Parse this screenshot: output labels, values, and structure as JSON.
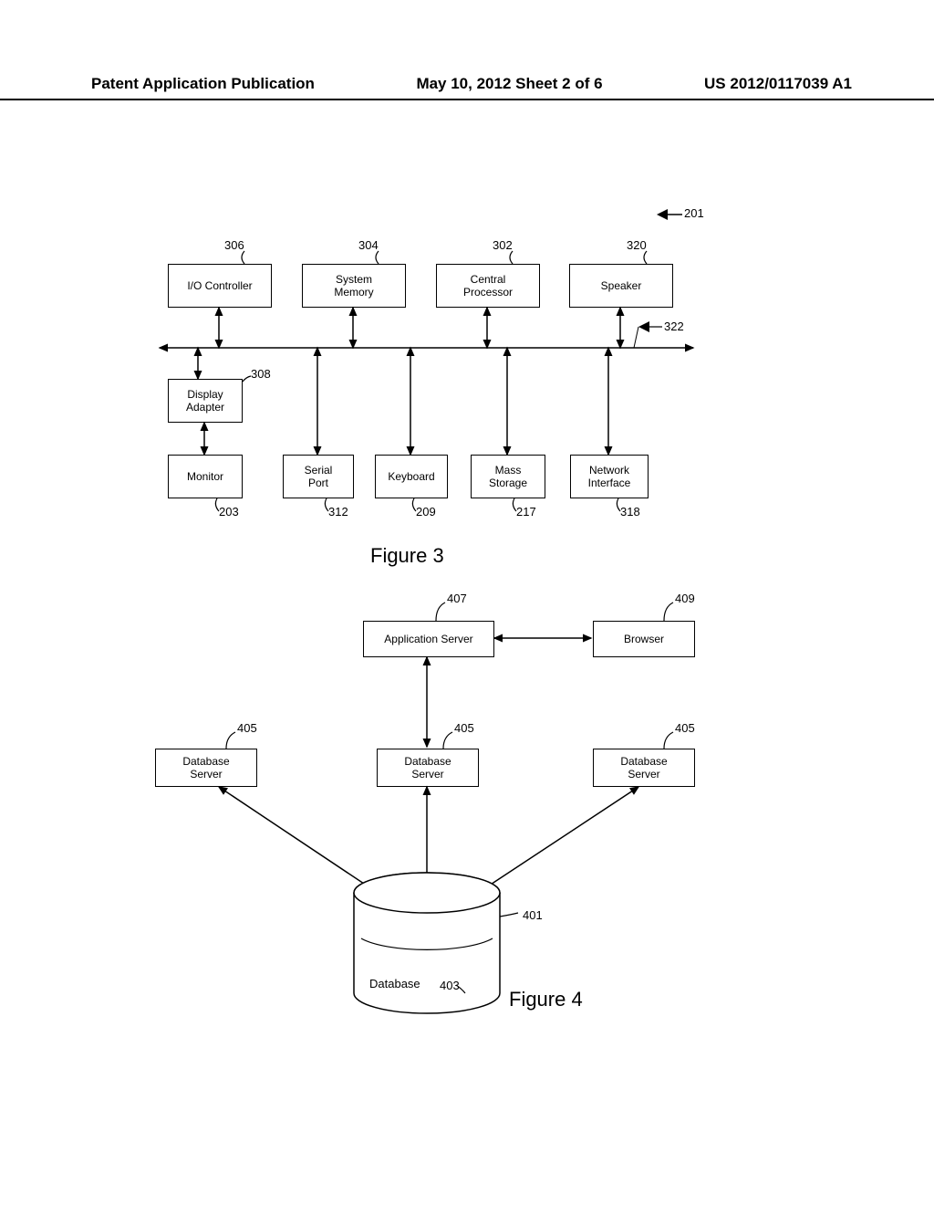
{
  "header": {
    "left": "Patent Application Publication",
    "center": "May 10, 2012  Sheet 2 of 6",
    "right": "US 2012/0117039 A1"
  },
  "fig3": {
    "title": "Figure 3",
    "ref_top": "201",
    "bus_ref": "322",
    "blocks": {
      "io_controller": {
        "label": "I/O Controller",
        "ref": "306"
      },
      "system_memory": {
        "label": "System\nMemory",
        "ref": "304"
      },
      "central_processor": {
        "label": "Central\nProcessor",
        "ref": "302"
      },
      "speaker": {
        "label": "Speaker",
        "ref": "320"
      },
      "display_adapter": {
        "label": "Display\nAdapter",
        "ref": "308"
      },
      "monitor": {
        "label": "Monitor",
        "ref": "203"
      },
      "serial_port": {
        "label": "Serial\nPort",
        "ref": "312"
      },
      "keyboard": {
        "label": "Keyboard",
        "ref": "209"
      },
      "mass_storage": {
        "label": "Mass\nStorage",
        "ref": "217"
      },
      "network_interface": {
        "label": "Network\nInterface",
        "ref": "318"
      }
    }
  },
  "fig4": {
    "title": "Figure 4",
    "blocks": {
      "app_server": {
        "label": "Application Server",
        "ref": "407"
      },
      "browser": {
        "label": "Browser",
        "ref": "409"
      },
      "db_server_1": {
        "label": "Database\nServer",
        "ref": "405"
      },
      "db_server_2": {
        "label": "Database\nServer",
        "ref": "405"
      },
      "db_server_3": {
        "label": "Database\nServer",
        "ref": "405"
      },
      "database": {
        "label": "Database",
        "ref_outer": "401",
        "ref_inner": "403"
      }
    }
  }
}
